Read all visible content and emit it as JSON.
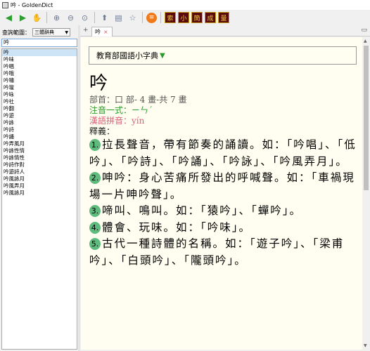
{
  "window": {
    "title": "吟 - GoldenDict"
  },
  "toolbar": {
    "dict_buttons": [
      "索",
      "小",
      "簡",
      "成",
      "量"
    ]
  },
  "left_pane": {
    "scope_label": "查詢範圍：",
    "scope_value": "三體辭典",
    "search_value": "吟",
    "words": [
      "吟",
      "吟味",
      "吟唱",
      "吟哦",
      "吟嘯",
      "吟壇",
      "吟咏",
      "吟社",
      "吟翻",
      "吟遊",
      "吟詠",
      "吟詩",
      "吟誦",
      "吟弄風月",
      "吟詠性情",
      "吟詠情性",
      "吟詩作對",
      "吟遊詩人",
      "吟風詠月",
      "吟風弄月",
      "吟風詠月"
    ]
  },
  "tab": {
    "label": "吟",
    "close": "×"
  },
  "article": {
    "dict_name": "教育部國語小字典",
    "headword": "吟",
    "bushou": "部首：口 部- 4 畫-共 7 畫",
    "zhuyin": "注音一式：ㄧㄣˊ",
    "pinyin": "漢語拼音：yín",
    "shiyi": "釋義：",
    "definitions": [
      {
        "num": "1.",
        "text": "拉長聲音，帶有節奏的誦讀。如：「吟唱」、「低吟」、「吟詩」、「吟誦」、「吟詠」、「吟風弄月」。"
      },
      {
        "num": "2.",
        "text": "呻吟：身心苦痛所發出的呼喊聲。如：「車禍現場一片呻吟聲」。"
      },
      {
        "num": "3.",
        "text": "啼叫、鳴叫。如：「猿吟」、「蟬吟」。"
      },
      {
        "num": "4.",
        "text": "體會、玩味。如：「吟味」。"
      },
      {
        "num": "5.",
        "text": "古代一種詩體的名稱。如：「遊子吟」、「梁甫吟」、「白頭吟」、「隴頭吟」。"
      }
    ]
  }
}
